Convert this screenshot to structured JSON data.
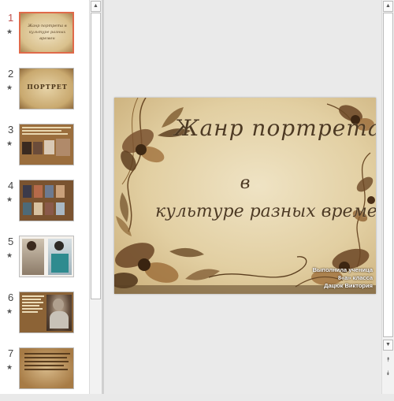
{
  "thumbnails": [
    {
      "number": "1",
      "marker": "★",
      "title": "Жанр портрета в культуре разных времен",
      "active": true
    },
    {
      "number": "2",
      "marker": "★",
      "title": "ПОРТРЕТ",
      "active": false
    },
    {
      "number": "3",
      "marker": "★",
      "title": "",
      "active": false
    },
    {
      "number": "4",
      "marker": "★",
      "title": "",
      "active": false
    },
    {
      "number": "5",
      "marker": "★",
      "title": "",
      "active": false
    },
    {
      "number": "6",
      "marker": "★",
      "title": "",
      "active": false
    },
    {
      "number": "7",
      "marker": "★",
      "title": "",
      "active": false
    }
  ],
  "slide": {
    "title_line1": "Жанр портрета",
    "title_line2": "в",
    "title_line3": "культуре разных времен",
    "author_line1": "Выполнила ученица",
    "author_line2": "8«а» класса",
    "author_line3": "Дацюк Виктория"
  },
  "scroll": {
    "up": "▲",
    "down": "▼",
    "prev_slide": "⯭",
    "next_slide": "⯯"
  },
  "colors": {
    "accent": "#e06a4a",
    "slide_text": "#4e3a22",
    "parchment": "#e2cfa2"
  }
}
